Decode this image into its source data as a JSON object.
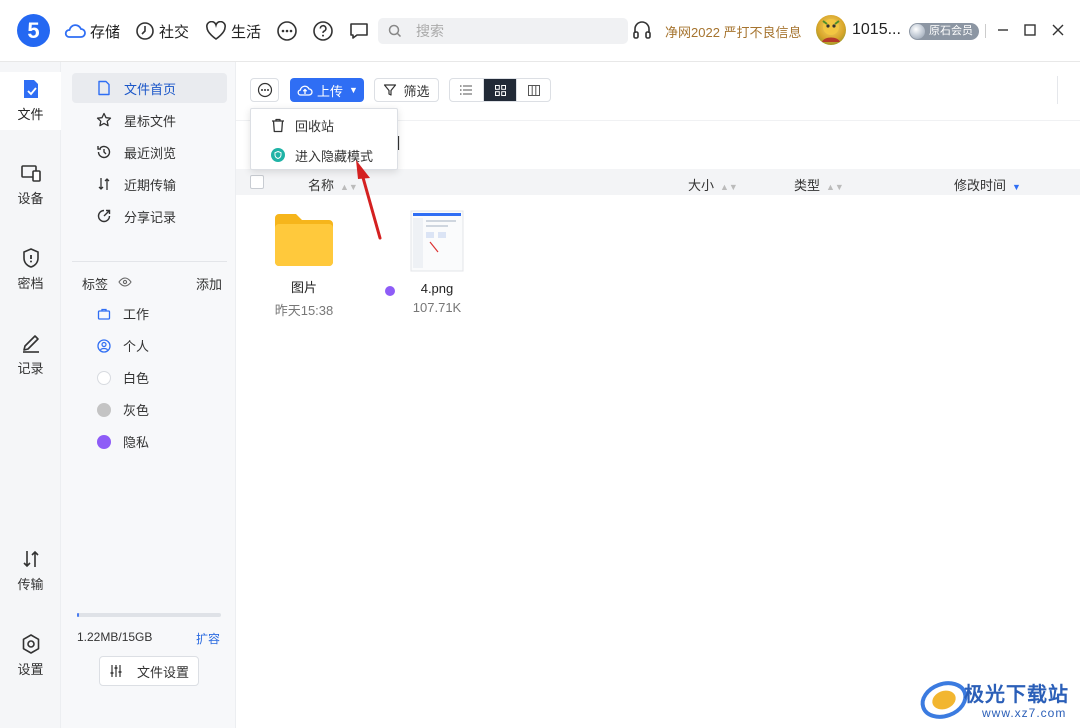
{
  "app": {
    "logo_text": "5",
    "nav": [
      {
        "label": "存储",
        "icon": "cloud-icon"
      },
      {
        "label": "社交",
        "icon": "clock-icon"
      },
      {
        "label": "生活",
        "icon": "heart-icon"
      }
    ],
    "search": {
      "placeholder": "搜索"
    },
    "promo": "净网2022 严打不良信息",
    "user": {
      "name": "1015...",
      "badge": "原石会员"
    }
  },
  "rail": [
    {
      "label": "文件",
      "icon": "file-icon",
      "active": true
    },
    {
      "label": "设备",
      "icon": "devices-icon"
    },
    {
      "label": "密档",
      "icon": "shield-icon"
    },
    {
      "label": "记录",
      "icon": "pen-icon"
    },
    {
      "label": "传输",
      "icon": "transfer-icon"
    },
    {
      "label": "设置",
      "icon": "settings-icon"
    }
  ],
  "sidebar": {
    "items": [
      {
        "label": "文件首页",
        "icon": "page-icon",
        "active": true
      },
      {
        "label": "星标文件",
        "icon": "star-icon"
      },
      {
        "label": "最近浏览",
        "icon": "history-icon"
      },
      {
        "label": "近期传输",
        "icon": "transfer-icon"
      },
      {
        "label": "分享记录",
        "icon": "share-icon"
      }
    ],
    "tags_label": "标签",
    "tags_add": "添加",
    "tags": [
      {
        "label": "工作",
        "color": "#2f6ef4",
        "icon": "briefcase-icon"
      },
      {
        "label": "个人",
        "color": "#2f6ef4",
        "icon": "person-icon"
      },
      {
        "label": "白色",
        "color": "#ffffff"
      },
      {
        "label": "灰色",
        "color": "#c4c4c4"
      },
      {
        "label": "隐私",
        "color": "#8e5cf7"
      }
    ],
    "storage": {
      "text": "1.22MB/15GB",
      "used_fraction": 0.0001,
      "expand": "扩容"
    },
    "file_settings": "文件设置"
  },
  "toolbar": {
    "upload": "上传",
    "filter": "筛选",
    "bracket": "]"
  },
  "menu": {
    "items": [
      {
        "label": "回收站",
        "icon": "trash-icon"
      },
      {
        "label": "进入隐藏模式",
        "icon": "hidden-mode-icon"
      }
    ]
  },
  "columns": {
    "name": "名称",
    "size": "大小",
    "type": "类型",
    "modified": "修改时间"
  },
  "files": [
    {
      "name": "图片",
      "meta": "昨天15:38",
      "kind": "folder"
    },
    {
      "name": "4.png",
      "meta": "107.71K",
      "kind": "image",
      "tag_color": "#8e5cf7"
    }
  ],
  "watermark": {
    "title": "极光下载站",
    "url": "www.xz7.com"
  }
}
